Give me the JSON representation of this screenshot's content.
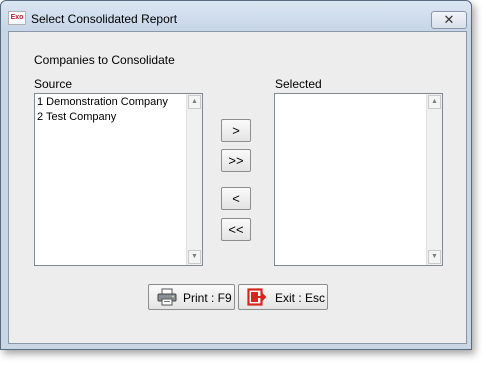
{
  "window": {
    "title": "Select Consolidated Report",
    "app_icon_text": "Exo",
    "close_glyph": "✕"
  },
  "dialog": {
    "heading": "Companies to Consolidate",
    "source_label": "Source",
    "selected_label": "Selected"
  },
  "source_items": [
    "1 Demonstration Company",
    "2 Test Company"
  ],
  "selected_items": [],
  "move_buttons": {
    "add": ">",
    "add_all": ">>",
    "remove": "<",
    "remove_all": "<<"
  },
  "actions": {
    "print_label": "Print : F9",
    "exit_label": "Exit : Esc"
  },
  "icons": {
    "print": "printer-icon",
    "exit": "exit-door-icon",
    "scroll_up": "scroll-up-arrow-icon",
    "scroll_down": "scroll-down-arrow-icon"
  },
  "colors": {
    "exit_accent": "#d9261c",
    "title_bar": "#c9d6e6"
  }
}
